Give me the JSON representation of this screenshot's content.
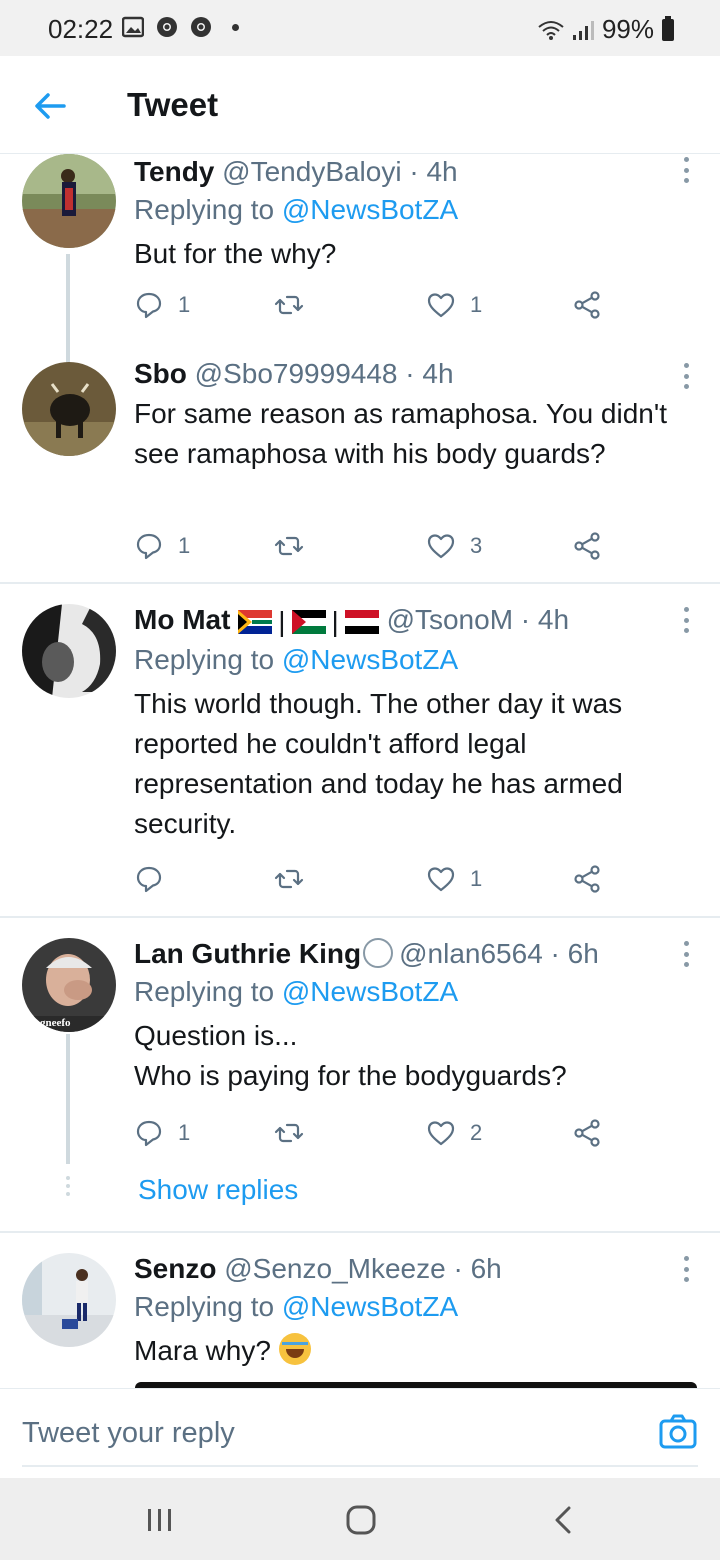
{
  "status_bar": {
    "time": "02:22",
    "battery": "99%"
  },
  "header": {
    "title": "Tweet",
    "back_icon": "arrow-left-icon"
  },
  "tweets": [
    {
      "name": "Tendy",
      "handle": "@TendyBaloyi",
      "time": "4h",
      "replying_prefix": "Replying to ",
      "replying_to": "@NewsBotZA",
      "text": "But for the why?",
      "replies": "1",
      "retweets": "",
      "likes": "1"
    },
    {
      "name": "Sbo",
      "handle": "@Sbo79999448",
      "time": "4h",
      "text": "For same reason as ramaphosa. You didn't see ramaphosa with his body guards?",
      "replies": "1",
      "retweets": "",
      "likes": "3"
    },
    {
      "name": "Mo Mat",
      "sep": "|",
      "handle": "@TsonoM",
      "time": "4h",
      "replying_prefix": "Replying to ",
      "replying_to": "@NewsBotZA",
      "text": "This world though. The other day it was reported he couldn't afford legal representation and today he has armed security.",
      "replies": "",
      "retweets": "",
      "likes": "1"
    },
    {
      "name": "Lan Guthrie King",
      "handle": "@nlan6564",
      "time": "6h",
      "replying_prefix": "Replying to ",
      "replying_to": "@NewsBotZA",
      "text_line1": "Question is...",
      "text_line2": "Who is paying for the bodyguards?",
      "replies": "1",
      "retweets": "",
      "likes": "2",
      "show_replies": "Show replies"
    },
    {
      "name": "Senzo",
      "handle": "@Senzo_Mkeeze",
      "time": "6h",
      "replying_prefix": "Replying to ",
      "replying_to": "@NewsBotZA",
      "text": "Mara why?",
      "emoji": "face-with-tears-of-joy"
    }
  ],
  "reply_box": {
    "placeholder": "Tweet your reply",
    "camera_icon": "camera-icon"
  },
  "nav_bar": {
    "recents_icon": "recents-icon",
    "home_icon": "home-icon",
    "back_icon": "back-chevron-icon"
  },
  "colors": {
    "accent": "#1d9bf0",
    "secondary_text": "#5b7083",
    "divider": "#e6ecf0"
  }
}
